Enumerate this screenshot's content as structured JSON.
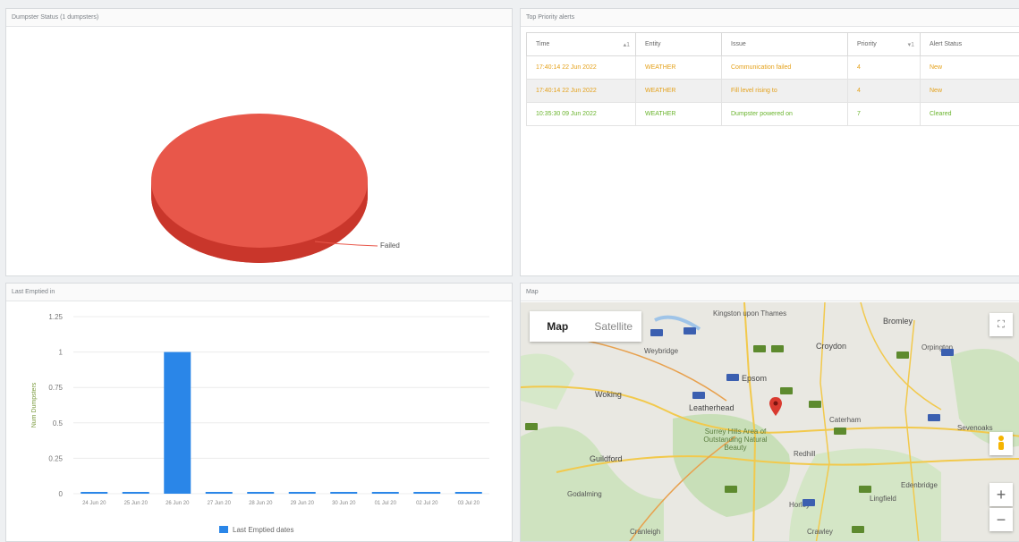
{
  "panels": {
    "pie": {
      "title": "Dumpster Status (1 dumpsters)"
    },
    "alerts": {
      "title": "Top Priority alerts"
    },
    "bar": {
      "title": "Last Emptied in"
    },
    "map": {
      "title": "Map"
    }
  },
  "pie": {
    "slices": [
      {
        "label": "Failed",
        "value": 1,
        "color": "#e8574a"
      }
    ]
  },
  "alerts": {
    "columns": [
      "Time",
      "Entity",
      "Issue",
      "Priority",
      "Alert Status"
    ],
    "rows": [
      {
        "time": "17:40:14 22 Jun 2022",
        "entity": "WEATHER",
        "issue": "Communication failed",
        "priority": "4",
        "status": "New",
        "color": "orange"
      },
      {
        "time": "17:40:14 22 Jun 2022",
        "entity": "WEATHER",
        "issue": "Fill level rising to",
        "priority": "4",
        "status": "New",
        "color": "orange"
      },
      {
        "time": "10:35:30 09 Jun 2022",
        "entity": "WEATHER",
        "issue": "Dumpster powered on",
        "priority": "7",
        "status": "Cleared",
        "color": "green"
      }
    ]
  },
  "chart_data": {
    "type": "bar",
    "categories": [
      "24 Jun 20",
      "25 Jun 20",
      "26 Jun 20",
      "27 Jun 20",
      "28 Jun 20",
      "29 Jun 20",
      "30 Jun 20",
      "01 Jul 20",
      "02 Jul 20",
      "03 Jul 20"
    ],
    "series": [
      {
        "name": "Last Emptied dates",
        "values": [
          0.01,
          0,
          1,
          0,
          0,
          0,
          0,
          0,
          0,
          0
        ]
      }
    ],
    "ylabel": "Num Dumpsters",
    "ylim": [
      0,
      1.25
    ],
    "yticks": [
      "1.25",
      "1",
      "0.75",
      "0.5",
      "0.25",
      "0"
    ],
    "color": "#2a86e8",
    "grid": true,
    "legend": "bottom"
  },
  "map": {
    "tabs": {
      "map": "Map",
      "satellite": "Satellite"
    },
    "places": [
      {
        "name": "Kingston upon Thames",
        "big": false
      },
      {
        "name": "Bromley",
        "big": true
      },
      {
        "name": "Weybridge",
        "big": false
      },
      {
        "name": "Croydon",
        "big": true
      },
      {
        "name": "Orpington",
        "big": false
      },
      {
        "name": "Woking",
        "big": true
      },
      {
        "name": "Epsom",
        "big": true
      },
      {
        "name": "Leatherhead",
        "big": true
      },
      {
        "name": "Caterham",
        "big": false
      },
      {
        "name": "Surrey Hills Area of Outstanding Natural Beauty",
        "big": false
      },
      {
        "name": "Guildford",
        "big": true
      },
      {
        "name": "Redhill",
        "big": false
      },
      {
        "name": "Sevenoaks",
        "big": false
      },
      {
        "name": "Edenbridge",
        "big": false
      },
      {
        "name": "Lingfield",
        "big": false
      },
      {
        "name": "Godalming",
        "big": false
      },
      {
        "name": "Horley",
        "big": false
      },
      {
        "name": "Cranleigh",
        "big": false
      },
      {
        "name": "Crawley",
        "big": false
      }
    ],
    "zoom_in": "+",
    "zoom_out": "−"
  }
}
